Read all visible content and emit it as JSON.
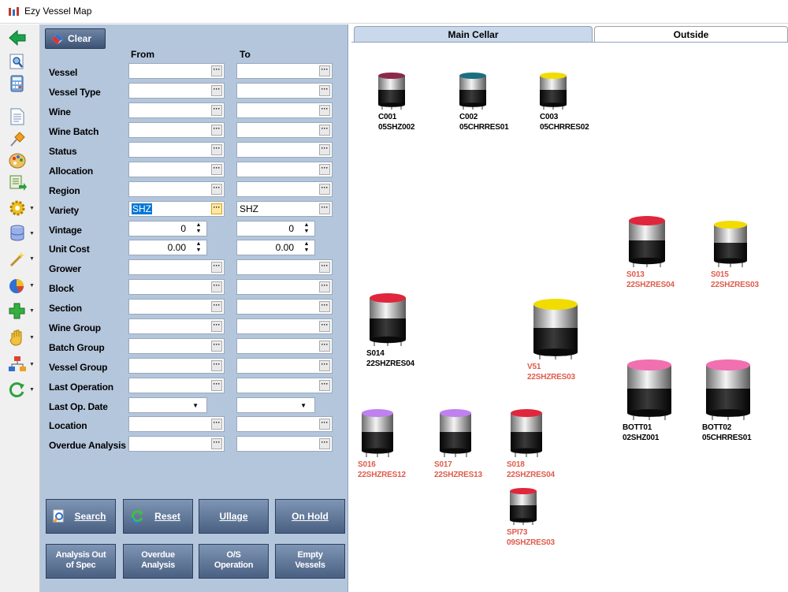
{
  "window": {
    "title": "Ezy Vessel Map"
  },
  "toolbar": {
    "icons": [
      "back-arrow-icon",
      "search-preview-icon",
      "calculator-icon",
      "document-icon",
      "pin-icon",
      "palette-icon",
      "export-icon",
      "gear-icon",
      "database-icon",
      "wand-icon",
      "chart-icon",
      "add-icon",
      "hand-icon",
      "hierarchy-icon",
      "refresh-icon"
    ]
  },
  "filters": {
    "clear_label": "Clear",
    "from_label": "From",
    "to_label": "To",
    "rows": [
      {
        "label": "Vessel",
        "from": "",
        "to": ""
      },
      {
        "label": "Vessel Type",
        "from": "",
        "to": ""
      },
      {
        "label": "Wine",
        "from": "",
        "to": ""
      },
      {
        "label": "Wine Batch",
        "from": "",
        "to": ""
      },
      {
        "label": "Status",
        "from": "",
        "to": ""
      },
      {
        "label": "Allocation",
        "from": "",
        "to": ""
      },
      {
        "label": "Region",
        "from": "",
        "to": ""
      },
      {
        "label": "Variety",
        "from": "SHZ",
        "to": "SHZ"
      },
      {
        "label": "Vintage",
        "from": "0",
        "to": "0"
      },
      {
        "label": "Unit Cost",
        "from": "0.00",
        "to": "0.00"
      },
      {
        "label": "Grower",
        "from": "",
        "to": ""
      },
      {
        "label": "Block",
        "from": "",
        "to": ""
      },
      {
        "label": "Section",
        "from": "",
        "to": ""
      },
      {
        "label": "Wine Group",
        "from": "",
        "to": ""
      },
      {
        "label": "Batch Group",
        "from": "",
        "to": ""
      },
      {
        "label": "Vessel Group",
        "from": "",
        "to": ""
      },
      {
        "label": "Last Operation",
        "from": "",
        "to": ""
      },
      {
        "label": "Last Op. Date",
        "from": "",
        "to": ""
      },
      {
        "label": "Location",
        "from": "",
        "to": ""
      },
      {
        "label": "Overdue Analysis",
        "from": "",
        "to": ""
      }
    ]
  },
  "actions": {
    "search": "Search",
    "reset": "Reset",
    "ullage": "Ullage",
    "on_hold": "On Hold",
    "analysis_out_1": "Analysis Out",
    "analysis_out_2": "of Spec",
    "overdue_1": "Overdue",
    "overdue_2": "Analysis",
    "os_1": "O/S",
    "os_2": "Operation",
    "empty_1": "Empty",
    "empty_2": "Vessels"
  },
  "tabs": {
    "main_cellar": "Main Cellar",
    "outside": "Outside"
  },
  "colors": {
    "panel": "#b4c6dc",
    "alert_text": "#e05a4a",
    "maroon": "#8a2a4a",
    "teal": "#1a6e7e",
    "yellow": "#f2dc00",
    "red": "#e0263c",
    "pink": "#f070b0",
    "purple": "#c080f0"
  },
  "vessels": [
    {
      "id": "C001",
      "batch": "05SHZ002",
      "lid": "maroon",
      "alert": false
    },
    {
      "id": "C002",
      "batch": "05CHRRES01",
      "lid": "teal",
      "alert": false
    },
    {
      "id": "C003",
      "batch": "05CHRRES02",
      "lid": "yellow",
      "alert": false
    },
    {
      "id": "S013",
      "batch": "22SHZRES04",
      "lid": "red",
      "alert": true
    },
    {
      "id": "S015",
      "batch": "22SHZRES03",
      "lid": "yellow",
      "alert": true
    },
    {
      "id": "S014",
      "batch": "22SHZRES04",
      "lid": "red",
      "alert": false
    },
    {
      "id": "V51",
      "batch": "22SHZRES03",
      "lid": "yellow",
      "alert": true
    },
    {
      "id": "BOTT01",
      "batch": "02SHZ001",
      "lid": "pink",
      "alert": false
    },
    {
      "id": "BOTT02",
      "batch": "05CHRRES01",
      "lid": "pink",
      "alert": false
    },
    {
      "id": "S016",
      "batch": "22SHZRES12",
      "lid": "purple",
      "alert": true
    },
    {
      "id": "S017",
      "batch": "22SHZRES13",
      "lid": "purple",
      "alert": true
    },
    {
      "id": "S018",
      "batch": "22SHZRES04",
      "lid": "red",
      "alert": true
    },
    {
      "id": "SPI73",
      "batch": "09SHZRES03",
      "lid": "red",
      "alert": true
    }
  ]
}
